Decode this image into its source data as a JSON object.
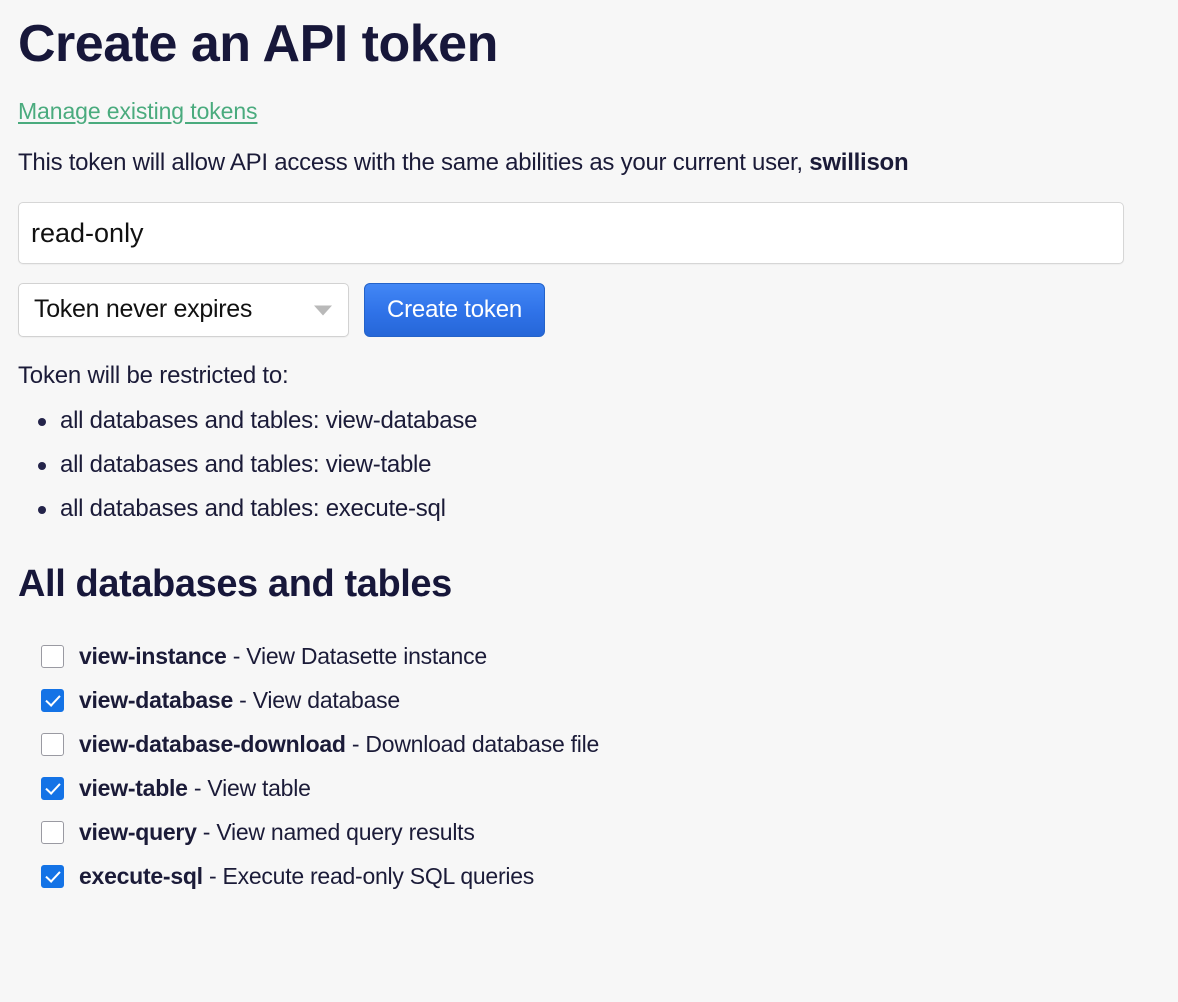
{
  "page": {
    "title": "Create an API token",
    "manage_link": "Manage existing tokens",
    "intro_prefix": "This token will allow API access with the same abilities as your current user, ",
    "intro_user": "swillison"
  },
  "form": {
    "token_name_value": "read-only",
    "token_name_placeholder": "",
    "expiry_selected": "Token never expires",
    "expiry_options": [
      "Token never expires"
    ],
    "create_button": "Create token"
  },
  "restrictions": {
    "label": "Token will be restricted to:",
    "items": [
      "all databases and tables: view-database",
      "all databases and tables: view-table",
      "all databases and tables: execute-sql"
    ]
  },
  "permissions_section": {
    "heading": "All databases and tables",
    "separator": " - ",
    "items": [
      {
        "name": "view-instance",
        "description": "View Datasette instance",
        "checked": false
      },
      {
        "name": "view-database",
        "description": "View database",
        "checked": true
      },
      {
        "name": "view-database-download",
        "description": "Download database file",
        "checked": false
      },
      {
        "name": "view-table",
        "description": "View table",
        "checked": true
      },
      {
        "name": "view-query",
        "description": "View named query results",
        "checked": false
      },
      {
        "name": "execute-sql",
        "description": "Execute read-only SQL queries",
        "checked": true
      }
    ]
  },
  "colors": {
    "background": "#f7f7f7",
    "heading": "#17173a",
    "text": "#1b1b38",
    "link_green": "#4aab7e",
    "accent_blue": "#1473e6",
    "button_blue": "#2f72e8",
    "checkbox_border": "#9a9aa2"
  },
  "icons": {
    "chevron": "chevron-down-icon",
    "check": "check-icon"
  }
}
